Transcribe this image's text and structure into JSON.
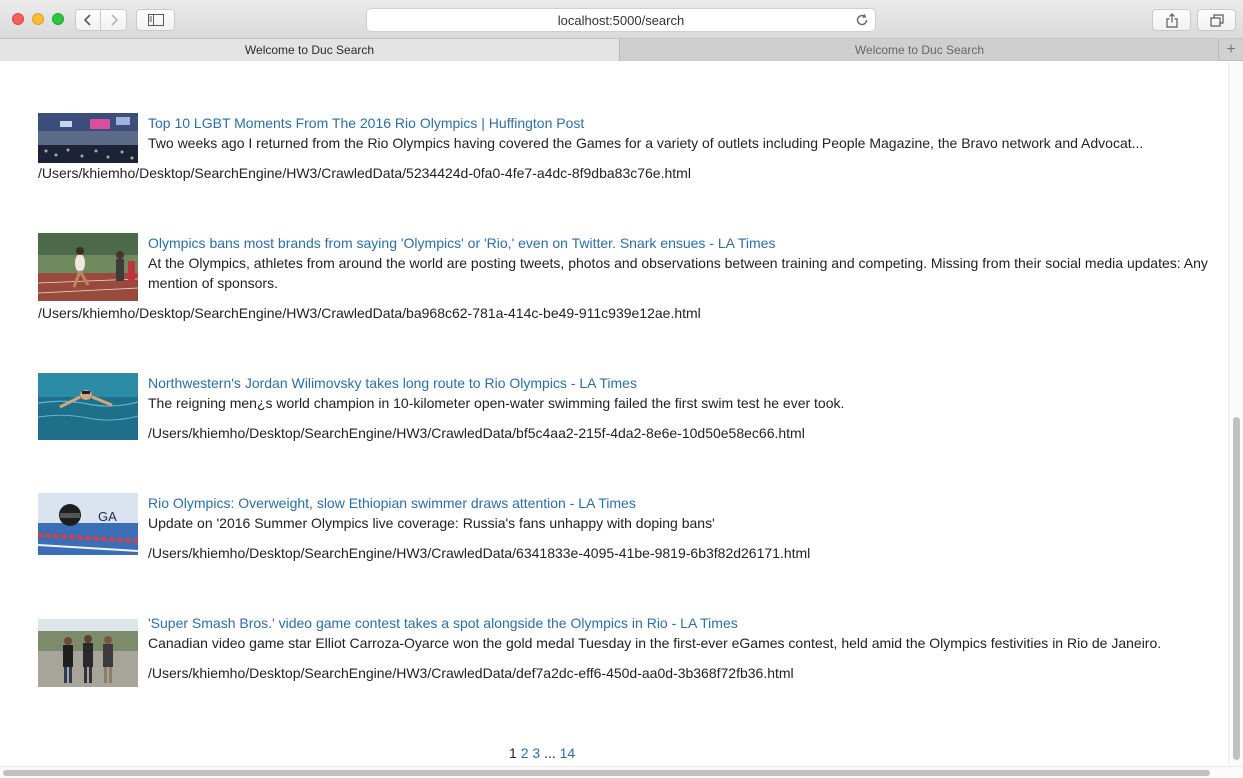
{
  "browser": {
    "url": "localhost:5000/search",
    "tabs": [
      {
        "label": "Welcome to Duc Search",
        "active": true
      },
      {
        "label": "Welcome to Duc Search",
        "active": false
      }
    ],
    "new_tab_label": "+"
  },
  "results": [
    {
      "title": "Top 10 LGBT Moments From The 2016 Rio Olympics | Huffington Post",
      "snippet": "Two weeks ago I returned from the Rio Olympics having covered the Games for a variety of outlets including People Magazine, the Bravo network and Advocat...",
      "path": "/Users/khiemho/Desktop/SearchEngine/HW3/CrawledData/5234424d-0fa0-4fe7-a4dc-8f9dba83c76e.html",
      "thumbnail": "stadium-crowd"
    },
    {
      "title": "Olympics bans most brands from saying 'Olympics' or 'Rio,' even on Twitter. Snark ensues - LA Times",
      "snippet": "At the Olympics, athletes from around the world are posting tweets, photos and observations between training and competing. Missing from their social media updates: Any mention of sponsors.",
      "path": "/Users/khiemho/Desktop/SearchEngine/HW3/CrawledData/ba968c62-781a-414c-be49-911c939e12ae.html",
      "thumbnail": "track-runners"
    },
    {
      "title": "Northwestern's Jordan Wilimovsky takes long route to Rio Olympics - LA Times",
      "snippet": "The reigning men¿s world champion in 10-kilometer open-water swimming failed the first swim test he ever took.",
      "path": "/Users/khiemho/Desktop/SearchEngine/HW3/CrawledData/bf5c4aa2-215f-4da2-8e6e-10d50e58ec66.html",
      "thumbnail": "swimmer-pool"
    },
    {
      "title": "Rio Olympics: Overweight, slow Ethiopian swimmer draws attention - LA Times",
      "snippet": "Update on '2016 Summer Olympics live coverage: Russia's fans unhappy with doping bans'",
      "path": "/Users/khiemho/Desktop/SearchEngine/HW3/CrawledData/6341833e-4095-41be-9819-6b3f82d26171.html",
      "thumbnail": "swimmer-lane",
      "thumbnail_text": "GA"
    },
    {
      "title": "'Super Smash Bros.' video game contest takes a spot alongside the Olympics in Rio - LA Times",
      "snippet": "Canadian video game star Elliot Carroza-Oyarce won the gold medal Tuesday in the first-ever eGames contest, held amid the Olympics festivities in Rio de Janeiro.",
      "path": "/Users/khiemho/Desktop/SearchEngine/HW3/CrawledData/def7a2dc-eff6-450d-aa0d-3b368f72fb36.html",
      "thumbnail": "three-people"
    }
  ],
  "pagination": {
    "current": "1",
    "pages": [
      "2",
      "3"
    ],
    "ellipsis": "...",
    "last": "14"
  },
  "colors": {
    "link": "#2a6eb0",
    "text": "#222222"
  }
}
